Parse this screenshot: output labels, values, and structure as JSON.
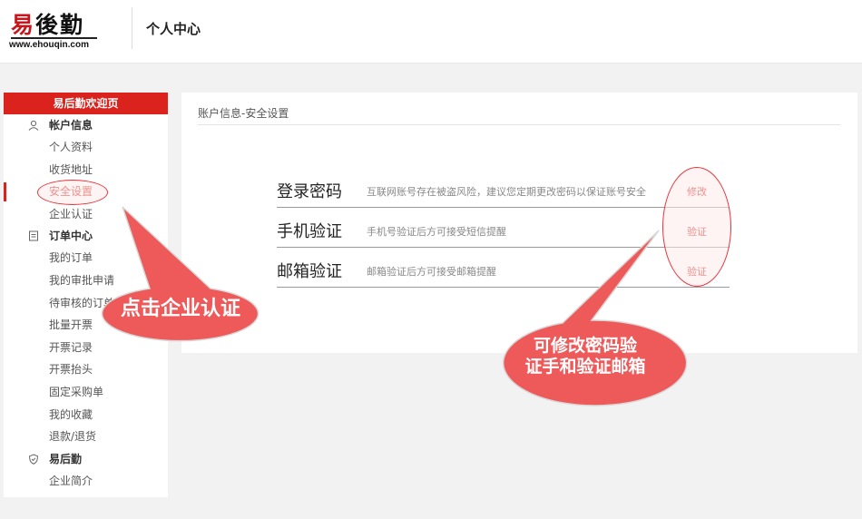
{
  "header": {
    "logo_cn_first": "易",
    "logo_cn_rest": "後勤",
    "logo_url": "www.ehouqin.com",
    "title": "个人中心"
  },
  "sidebar": {
    "welcome": "易后勤欢迎页",
    "groups": [
      {
        "label": "帐户信息",
        "icon": "user-icon",
        "items": [
          "个人资料",
          "收货地址",
          "安全设置",
          "企业认证"
        ]
      },
      {
        "label": "订单中心",
        "icon": "document-icon",
        "items": [
          "我的订单",
          "我的审批申请",
          "待审核的订单",
          "批量开票",
          "开票记录",
          "开票抬头",
          "固定采购单",
          "我的收藏",
          "退款/退货"
        ]
      },
      {
        "label": "易后勤",
        "icon": "shield-icon",
        "items": [
          "企业简介"
        ]
      }
    ],
    "active_item": "安全设置"
  },
  "content": {
    "breadcrumb": "账户信息-安全设置",
    "rows": [
      {
        "title": "登录密码",
        "desc": "互联网账号存在被盗风险，建议您定期更改密码以保证账号安全",
        "action": "修改"
      },
      {
        "title": "手机验证",
        "desc": "手机号验证后方可接受短信提醒",
        "action": "验证"
      },
      {
        "title": "邮箱验证",
        "desc": "邮箱验证后方可接受邮箱提醒",
        "action": "验证"
      }
    ]
  },
  "annotations": {
    "left_callout": "点击企业认证",
    "right_callout_line1": "可修改密码验",
    "right_callout_line2": "证手和验证邮箱"
  },
  "colors": {
    "brand_red": "#d9231c",
    "callout_red": "#ee5a5a",
    "highlight_border": "#e8343a"
  }
}
